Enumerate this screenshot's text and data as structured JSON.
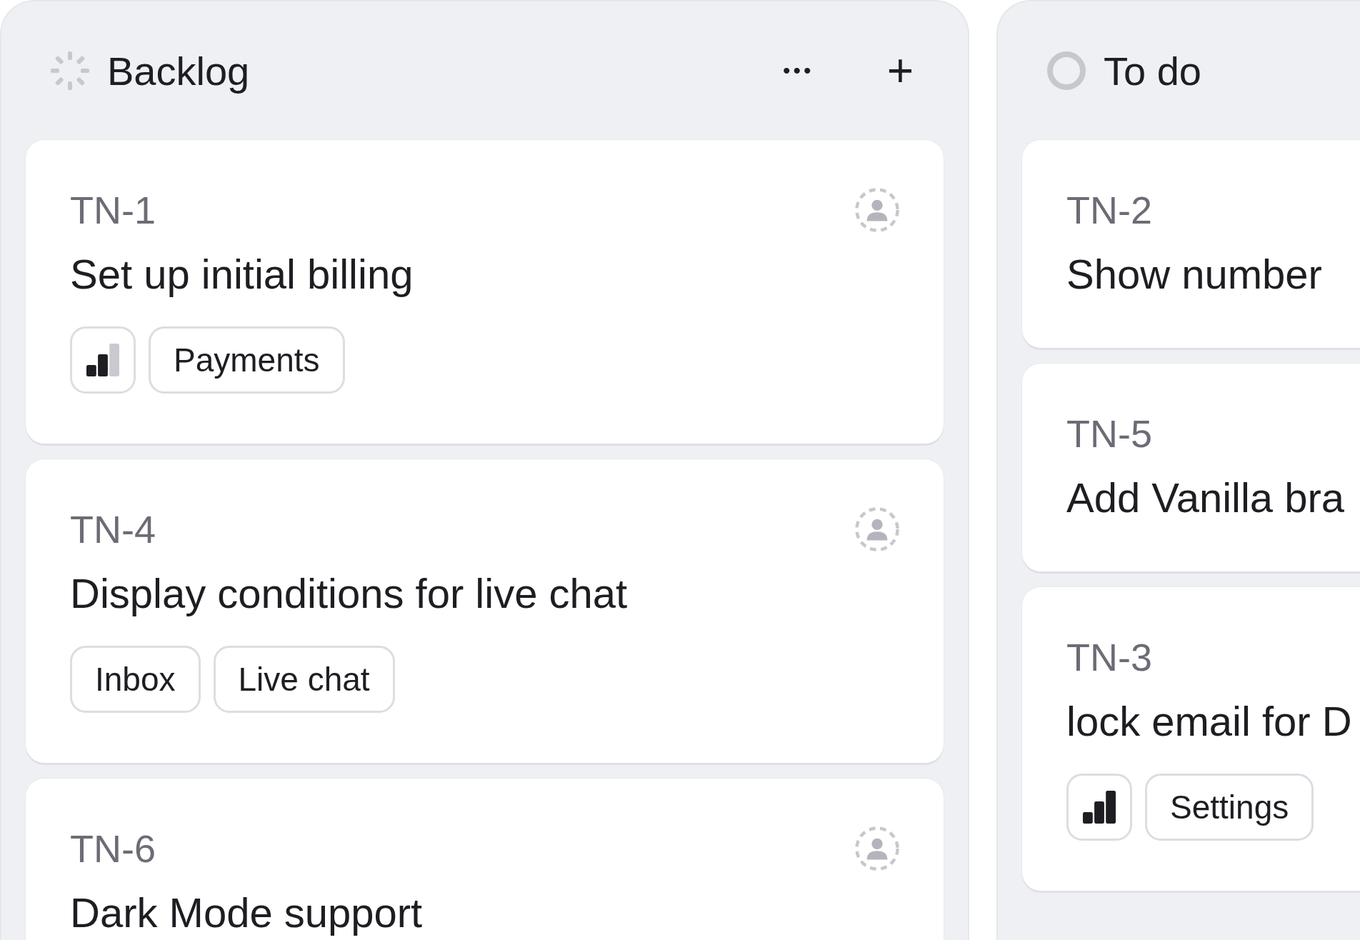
{
  "columns": [
    {
      "title": "Backlog",
      "kind": "backlog",
      "more_label": "•••",
      "add_label": "+",
      "cards": [
        {
          "id": "TN-1",
          "title": "Set up initial billing",
          "assignee": {
            "kind": "unassigned"
          },
          "priority": {
            "level": 0.67
          },
          "tags": [
            "Payments"
          ]
        },
        {
          "id": "TN-4",
          "title": "Display conditions for live chat",
          "assignee": {
            "kind": "unassigned"
          },
          "tags": [
            "Inbox",
            "Live chat"
          ]
        },
        {
          "id": "TN-6",
          "title": "Dark Mode support",
          "assignee": {
            "kind": "unassigned"
          }
        }
      ]
    },
    {
      "title": "To do",
      "kind": "todo",
      "cards": [
        {
          "id": "TN-2",
          "title": "Show number"
        },
        {
          "id": "TN-5",
          "title": "Add Vanilla bra"
        },
        {
          "id": "TN-3",
          "title": "lock email for D",
          "priority": {
            "level": 1
          },
          "tags": [
            "Settings"
          ]
        }
      ]
    }
  ]
}
